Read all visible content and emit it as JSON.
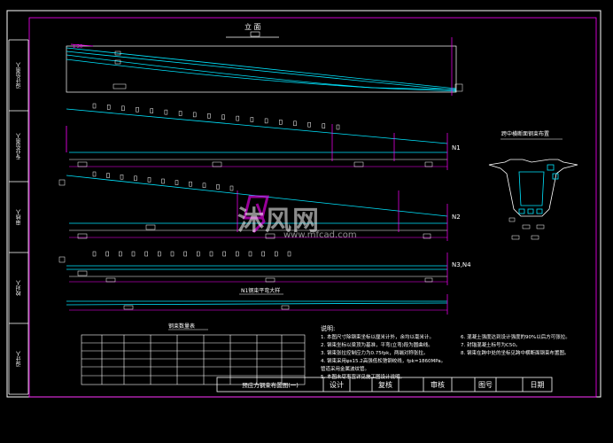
{
  "drawing": {
    "elevation_title": "立 面",
    "section_title": "跨中横断面钢束布置",
    "bottom_label": "N1钢束平弯大样",
    "table_title": "钢束数量表",
    "rows": [
      "N1",
      "N2",
      "N3,N4"
    ]
  },
  "sidebar": [
    {
      "label": "设计负责人"
    },
    {
      "label": "专业负责人"
    },
    {
      "label": "审核人"
    },
    {
      "label": "校对人"
    },
    {
      "label": "设计人"
    }
  ],
  "notes": {
    "heading": "说明:",
    "left": [
      "1. 本图尺寸除钢束坐标以厘米计外，余均以毫米计。",
      "2. 钢束坐标以梁顶为基准，平弯(立弯)段为圆曲线。",
      "3. 钢束张拉控制应力为0.75fpk，两端对称张拉。",
      "4. 钢束采用φs15.2高强低松弛钢绞线，fpk=1860MPa。",
      "   管道采用金属波纹管。",
      "5. 本图未尽事宜详见施工图设计说明。"
    ],
    "right": [
      "6. 混凝土强度达到设计强度的90%以后方可张拉。",
      "7. 封锚混凝土标号为C50。",
      "8. 钢束在跨中处的坐标见跨中横断面钢束布置图。"
    ]
  },
  "titleblock": {
    "title": "预应力钢束布置图(一)",
    "design": "设计",
    "review": "复核",
    "check": "审核",
    "drawing_no": "图号",
    "date": "日期"
  },
  "watermark": {
    "name": "沐风网",
    "url": "www.mfcad.com"
  },
  "colors": {
    "background": "#000000",
    "frame": "#ffffff",
    "magenta": "#ff00ff",
    "cyan": "#00e5ff",
    "yellow": "#ffff00"
  }
}
